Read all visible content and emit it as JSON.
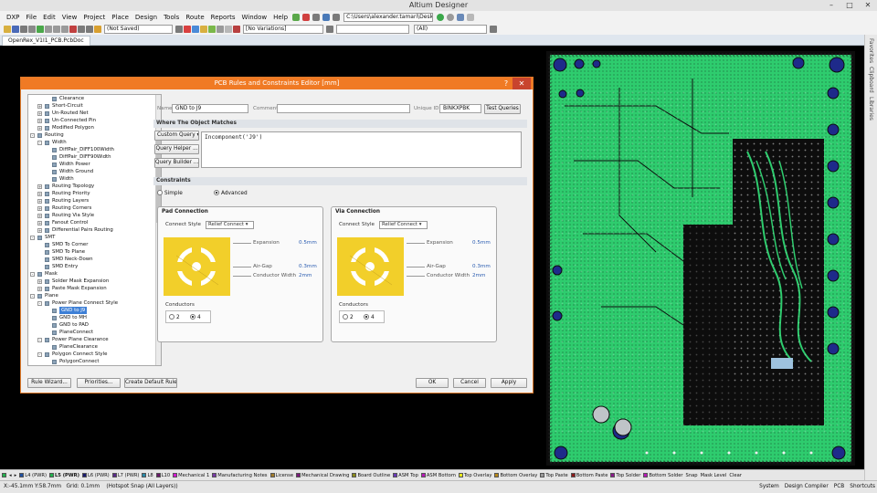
{
  "app": {
    "title": "Altium Designer"
  },
  "menu": [
    "DXP",
    "File",
    "Edit",
    "View",
    "Project",
    "Place",
    "Design",
    "Tools",
    "Route",
    "Reports",
    "Window",
    "Help"
  ],
  "toolbar": {
    "path": "C:\\Users\\alexander.tamari\\Deskto",
    "save_state": "(Not Saved)",
    "variants": "[No Variations]",
    "filter": "(All)"
  },
  "doc": {
    "tab": "OpenRex_V1I1_PCB.PcbDoc"
  },
  "right_panels": [
    "Favorites",
    "Clipboard",
    "Libraries"
  ],
  "dialog": {
    "title": "PCB Rules and Constraints Editor [mm]",
    "help": "?",
    "close": "✕",
    "name_label": "Name",
    "name_value": "GND to J9",
    "comment_label": "Comment",
    "comment_value": "",
    "unique_label": "Unique ID",
    "unique_value": "BINKXPBK",
    "test_queries": "Test Queries",
    "where_header": "Where The Object Matches",
    "custom_query": "Custom Query",
    "query_helper": "Query Helper ...",
    "query_builder": "Query Builder ...",
    "query_text": "Incomponent('J9')",
    "constraints_header": "Constraints",
    "simple": "Simple",
    "advanced": "Advanced",
    "pad_connection": {
      "title": "Pad Connection",
      "connect_style_label": "Connect Style",
      "connect_style": "Relief Connect",
      "expansion_label": "Expansion",
      "expansion": "0.5mm",
      "airgap_label": "Air-Gap",
      "airgap": "0.3mm",
      "conductor_width_label": "Conductor Width",
      "conductor_width": "2mm",
      "conductors_label": "Conductors",
      "opt2": "2",
      "opt4": "4"
    },
    "via_connection": {
      "title": "Via Connection",
      "connect_style_label": "Connect Style",
      "connect_style": "Relief Connect",
      "expansion_label": "Expansion",
      "expansion": "0.5mm",
      "airgap_label": "Air-Gap",
      "airgap": "0.3mm",
      "conductor_width_label": "Conductor Width",
      "conductor_width": "2mm",
      "conductors_label": "Conductors",
      "opt2": "2",
      "opt4": "4"
    },
    "rule_wizard": "Rule Wizard...",
    "priorities": "Priorities...",
    "create_default": "Create Default Rules",
    "ok": "OK",
    "cancel": "Cancel",
    "apply": "Apply"
  },
  "tree": [
    {
      "label": "Clearance",
      "level": 4,
      "exp": "",
      "icon": true
    },
    {
      "label": "Short-Circuit",
      "level": 3,
      "exp": "+",
      "icon": true
    },
    {
      "label": "Un-Routed Net",
      "level": 3,
      "exp": "+",
      "icon": true
    },
    {
      "label": "Un-Connected Pin",
      "level": 3,
      "exp": "+",
      "icon": true
    },
    {
      "label": "Modified Polygon",
      "level": 3,
      "exp": "+",
      "icon": true
    },
    {
      "label": "Routing",
      "level": 2,
      "exp": "-",
      "icon": true
    },
    {
      "label": "Width",
      "level": 3,
      "exp": "-",
      "icon": true
    },
    {
      "label": "DiffPair_DIFF100Width",
      "level": 4,
      "exp": "",
      "icon": true
    },
    {
      "label": "DiffPair_DIFF90Width",
      "level": 4,
      "exp": "",
      "icon": true
    },
    {
      "label": "Width Power",
      "level": 4,
      "exp": "",
      "icon": true
    },
    {
      "label": "Width Ground",
      "level": 4,
      "exp": "",
      "icon": true
    },
    {
      "label": "Width",
      "level": 4,
      "exp": "",
      "icon": true
    },
    {
      "label": "Routing Topology",
      "level": 3,
      "exp": "+",
      "icon": true
    },
    {
      "label": "Routing Priority",
      "level": 3,
      "exp": "+",
      "icon": true
    },
    {
      "label": "Routing Layers",
      "level": 3,
      "exp": "+",
      "icon": true
    },
    {
      "label": "Routing Corners",
      "level": 3,
      "exp": "+",
      "icon": true
    },
    {
      "label": "Routing Via Style",
      "level": 3,
      "exp": "+",
      "icon": true
    },
    {
      "label": "Fanout Control",
      "level": 3,
      "exp": "+",
      "icon": true
    },
    {
      "label": "Differential Pairs Routing",
      "level": 3,
      "exp": "+",
      "icon": true
    },
    {
      "label": "SMT",
      "level": 2,
      "exp": "-",
      "icon": true
    },
    {
      "label": "SMD To Corner",
      "level": 3,
      "exp": "",
      "icon": true
    },
    {
      "label": "SMD To Plane",
      "level": 3,
      "exp": "",
      "icon": true
    },
    {
      "label": "SMD Neck-Down",
      "level": 3,
      "exp": "",
      "icon": true
    },
    {
      "label": "SMD Entry",
      "level": 3,
      "exp": "",
      "icon": true
    },
    {
      "label": "Mask",
      "level": 2,
      "exp": "-",
      "icon": true
    },
    {
      "label": "Solder Mask Expansion",
      "level": 3,
      "exp": "+",
      "icon": true
    },
    {
      "label": "Paste Mask Expansion",
      "level": 3,
      "exp": "+",
      "icon": true
    },
    {
      "label": "Plane",
      "level": 2,
      "exp": "-",
      "icon": true
    },
    {
      "label": "Power Plane Connect Style",
      "level": 3,
      "exp": "-",
      "icon": true
    },
    {
      "label": "GND to J9",
      "level": 4,
      "exp": "",
      "icon": true,
      "selected": true
    },
    {
      "label": "GND to MH",
      "level": 4,
      "exp": "",
      "icon": true
    },
    {
      "label": "GND to PAD",
      "level": 4,
      "exp": "",
      "icon": true
    },
    {
      "label": "PlaneConnect",
      "level": 4,
      "exp": "",
      "icon": true
    },
    {
      "label": "Power Plane Clearance",
      "level": 3,
      "exp": "-",
      "icon": true
    },
    {
      "label": "PlaneClearance",
      "level": 4,
      "exp": "",
      "icon": true
    },
    {
      "label": "Polygon Connect Style",
      "level": 3,
      "exp": "-",
      "icon": true
    },
    {
      "label": "PolygonConnect",
      "level": 4,
      "exp": "",
      "icon": true
    }
  ],
  "layers": [
    {
      "label": "L4 (PWR)",
      "color": "#1e4fa0"
    },
    {
      "label": "L5 (PWR)",
      "color": "#23b14d",
      "active": true
    },
    {
      "label": "L6 (PWR)",
      "color": "#1a1a6e"
    },
    {
      "label": "L7 (PWR)",
      "color": "#5a2a8a"
    },
    {
      "label": "L8",
      "color": "#2a8aa8"
    },
    {
      "label": "L10",
      "color": "#6a1a6a"
    },
    {
      "label": "Mechanical 1",
      "color": "#d41ad4"
    },
    {
      "label": "Manufacturing Notes",
      "color": "#7a3aa8"
    },
    {
      "label": "License",
      "color": "#a07a2a"
    },
    {
      "label": "Mechanical Drawing",
      "color": "#7a1a7a"
    },
    {
      "label": "Board Outline",
      "color": "#8a8a1a"
    },
    {
      "label": "ASM Top",
      "color": "#6a3ab8"
    },
    {
      "label": "ASM Bottom",
      "color": "#b81ab8"
    },
    {
      "label": "Top Overlay",
      "color": "#e8e81a"
    },
    {
      "label": "Bottom Overlay",
      "color": "#b8881a"
    },
    {
      "label": "Top Paste",
      "color": "#9a9a9a"
    },
    {
      "label": "Bottom Paste",
      "color": "#8a1a1a"
    },
    {
      "label": "Top Solder",
      "color": "#8a1a8a"
    },
    {
      "label": "Bottom Solder",
      "color": "#b81ab8"
    }
  ],
  "layer_controls": [
    "Snap",
    "Mask Level",
    "Clear"
  ],
  "status": {
    "coords": "X:-45.1mm Y:58.7mm",
    "grid": "Grid: 0.1mm",
    "snap": "(Hotspot Snap (All Layers))",
    "right": [
      "System",
      "Design Compiler",
      "PCB",
      "Shortcuts"
    ]
  },
  "colors": {
    "accent": "#f07a24",
    "pcb_green": "#2ecc6e",
    "pad_yellow": "#f2cf2a"
  }
}
